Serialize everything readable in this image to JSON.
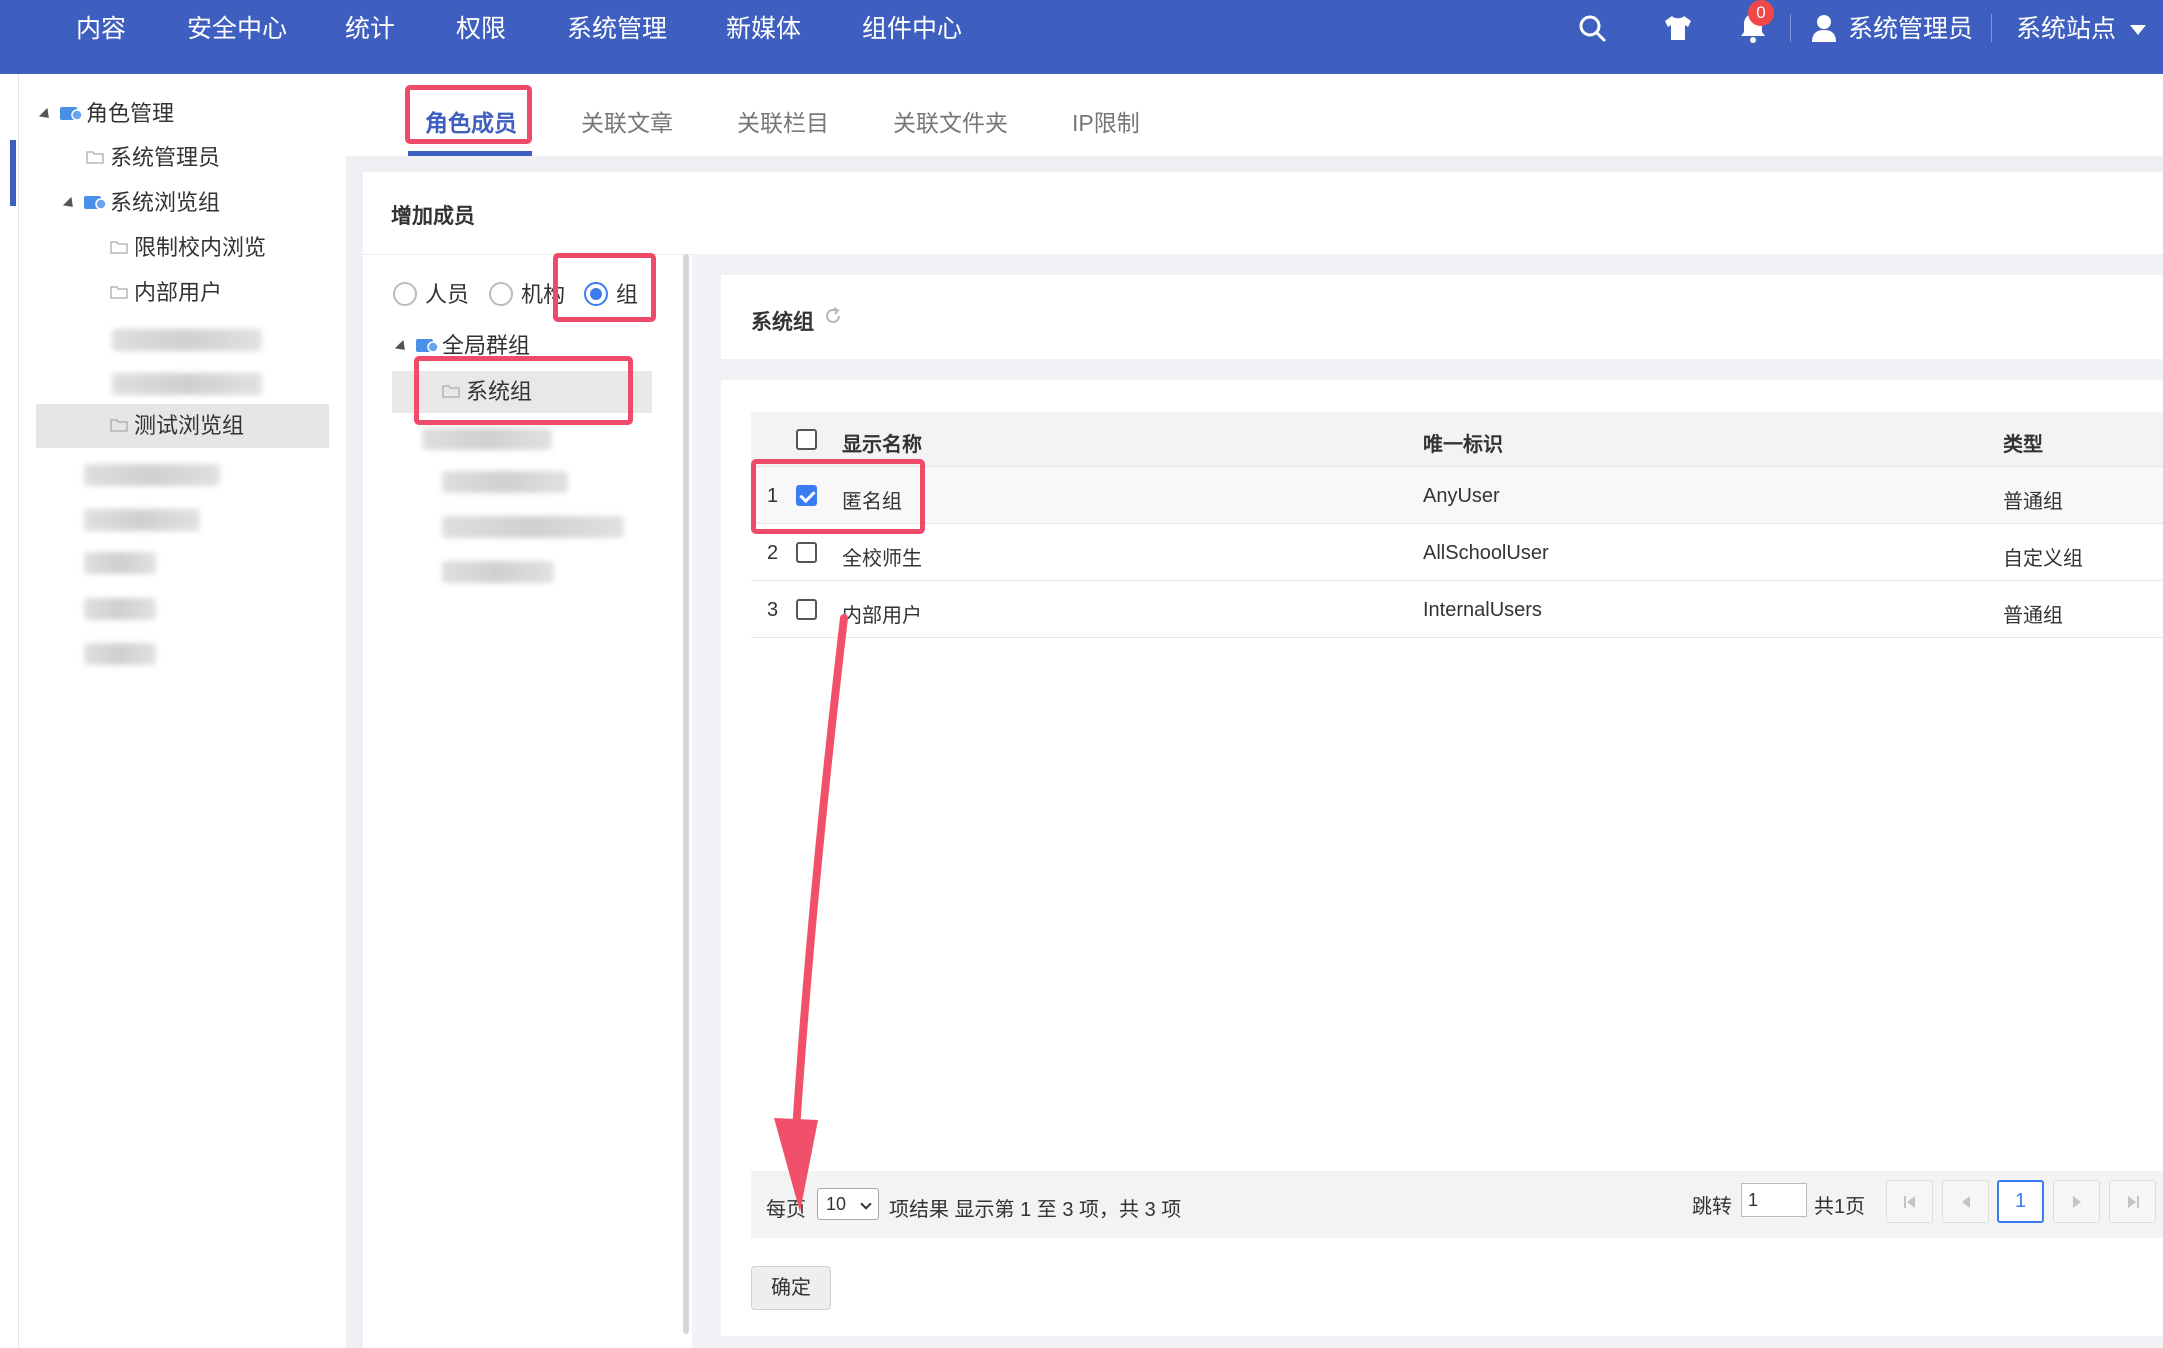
{
  "topnav": {
    "items": [
      "内容",
      "安全中心",
      "统计",
      "权限",
      "系统管理",
      "新媒体",
      "组件中心"
    ],
    "icons": [
      "search-icon",
      "shirt-icon",
      "bell-icon",
      "user-icon"
    ],
    "notification_count": "0",
    "user_name": "系统管理员",
    "site_label": "系统站点",
    "bg_color": "#3f5fc0"
  },
  "sidebar": {
    "root": "角色管理",
    "items": [
      "系统管理员",
      "系统浏览组",
      "限制校内浏览",
      "内部用户",
      "测试浏览组"
    ]
  },
  "tabs": [
    "角色成员",
    "关联文章",
    "关联栏目",
    "关联文件夹",
    "IP限制"
  ],
  "panel": {
    "title": "增加成员",
    "radios": [
      "人员",
      "机构",
      "组"
    ],
    "group_tree": {
      "root": "全局群组",
      "selected": "系统组"
    }
  },
  "card": {
    "title": "系统组"
  },
  "table": {
    "headers": [
      "显示名称",
      "唯一标识",
      "类型"
    ],
    "rows": [
      {
        "index": "1",
        "checked": true,
        "name": "匿名组",
        "id": "AnyUser",
        "type": "普通组"
      },
      {
        "index": "2",
        "checked": false,
        "name": "全校师生",
        "id": "AllSchoolUser",
        "type": "自定义组"
      },
      {
        "index": "3",
        "checked": false,
        "name": "内部用户",
        "id": "InternalUsers",
        "type": "普通组"
      }
    ]
  },
  "pagination": {
    "per_page_label": "每页",
    "per_page_value": "10",
    "summary": "项结果 显示第 1 至 3 项，共 3 项",
    "jump_label": "跳转",
    "jump_value": "1",
    "total_pages": "共1页",
    "current_page": "1"
  },
  "actions": {
    "confirm": "确定"
  },
  "accent_color": "#3c7cf2",
  "highlight_color": "#f04a6a"
}
